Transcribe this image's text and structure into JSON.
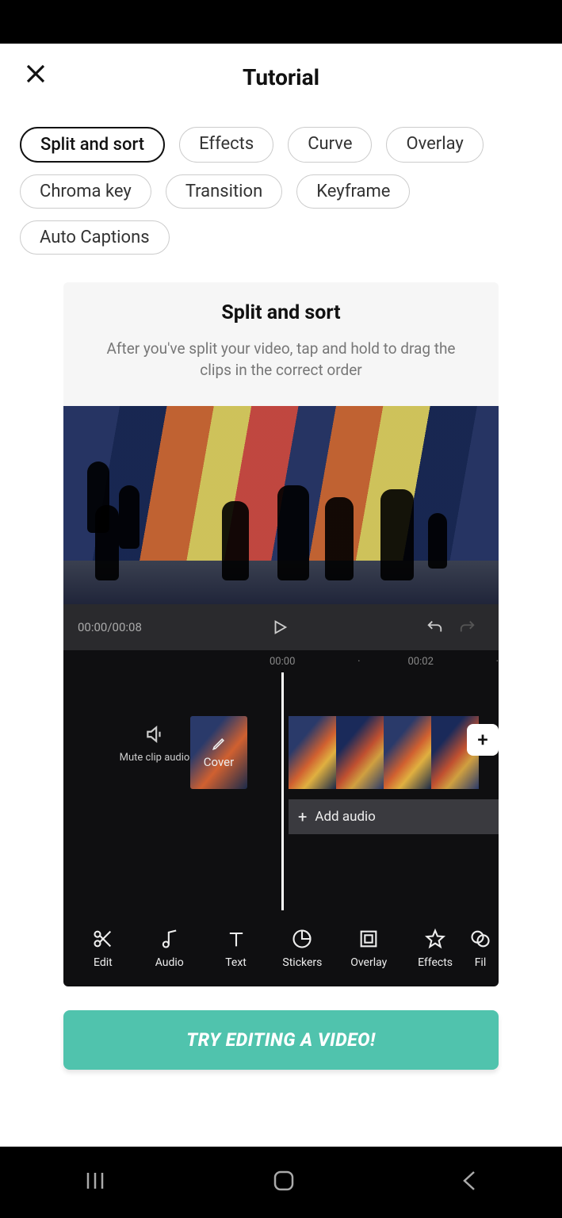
{
  "header": {
    "title": "Tutorial"
  },
  "chips": [
    "Split and sort",
    "Effects",
    "Curve",
    "Overlay",
    "Chroma key",
    "Transition",
    "Keyframe",
    "Auto Captions"
  ],
  "active_chip_index": 0,
  "card": {
    "title": "Split and sort",
    "description": "After you've split your video, tap and hold to drag the clips in the correct order"
  },
  "player": {
    "time": "00:00/00:08",
    "ruler": [
      "00:00",
      "·",
      "00:02",
      "·"
    ],
    "mute_label": "Mute clip audio",
    "cover_label": "Cover",
    "add_audio_label": "Add audio"
  },
  "tools": [
    "Edit",
    "Audio",
    "Text",
    "Stickers",
    "Overlay",
    "Effects",
    "Fil"
  ],
  "cta": "TRY EDITING A VIDEO!"
}
